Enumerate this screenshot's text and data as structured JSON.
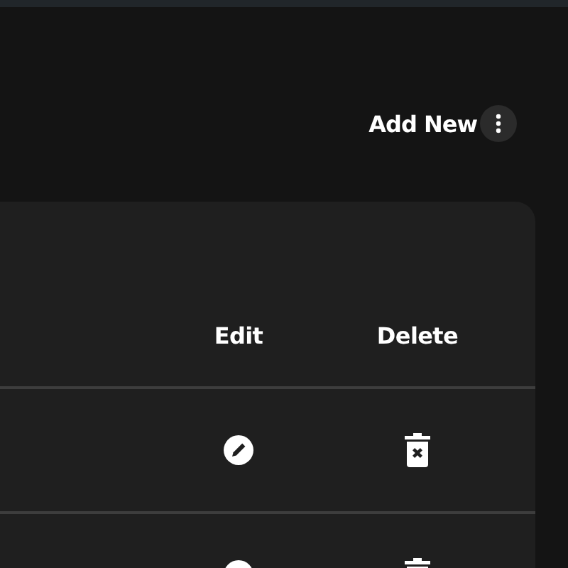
{
  "header": {
    "add_button": {
      "label": "Add New"
    }
  },
  "table": {
    "columns": [
      "Edit",
      "Delete"
    ],
    "rows": [
      {
        "editable": true,
        "deletable": true
      },
      {
        "editable": true,
        "deletable": true
      }
    ]
  }
}
